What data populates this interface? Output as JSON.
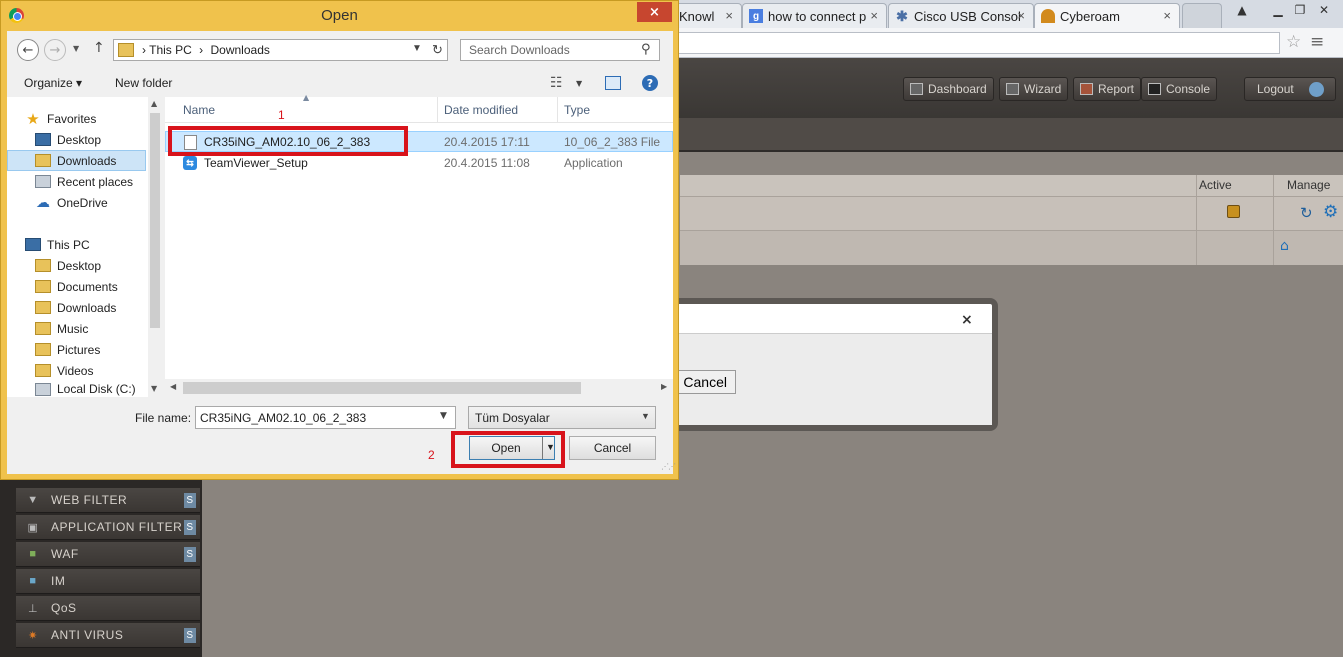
{
  "browser": {
    "tabs": [
      {
        "label": "Knowl"
      },
      {
        "label": "how to connect p"
      },
      {
        "label": "Cisco USB Consol"
      },
      {
        "label": "Cyberoam"
      }
    ]
  },
  "cyberoam": {
    "header_buttons": [
      {
        "label": "Dashboard"
      },
      {
        "label": "Wizard"
      },
      {
        "label": "Report"
      },
      {
        "label": "Console"
      }
    ],
    "logout_label": "Logout",
    "grid": {
      "col_active": "Active",
      "col_manage": "Manage"
    },
    "modal": {
      "cancel_label": "Cancel",
      "close": "×"
    },
    "sidebar": {
      "items": [
        {
          "label": "WEB FILTER",
          "badge": "S"
        },
        {
          "label": "APPLICATION FILTER",
          "badge": "S"
        },
        {
          "label": "WAF",
          "badge": "S"
        },
        {
          "label": "IM"
        },
        {
          "label": "QoS"
        },
        {
          "label": "ANTI VIRUS",
          "badge": "S"
        }
      ]
    }
  },
  "dialog": {
    "title": "Open",
    "close": "×",
    "address": {
      "segments": [
        "This PC",
        "Downloads"
      ],
      "separator": "›"
    },
    "search": {
      "placeholder": "Search Downloads"
    },
    "toolbar": {
      "organize": "Organize ▾",
      "new_folder": "New folder"
    },
    "nav": {
      "favorites": "Favorites",
      "fav_items": [
        "Desktop",
        "Downloads",
        "Recent places",
        "OneDrive"
      ],
      "this_pc": "This PC",
      "pc_items": [
        "Desktop",
        "Documents",
        "Downloads",
        "Music",
        "Pictures",
        "Videos",
        "Local Disk (C:)"
      ]
    },
    "columns": {
      "name": "Name",
      "date": "Date modified",
      "type": "Type"
    },
    "files": [
      {
        "name": "CR35iNG_AM02.10_06_2_383",
        "date": "20.4.2015 17:11",
        "type": "10_06_2_383 File"
      },
      {
        "name": "TeamViewer_Setup",
        "date": "20.4.2015 11:08",
        "type": "Application"
      }
    ],
    "file_name_label": "File name:",
    "file_name_value": "CR35iNG_AM02.10_06_2_383",
    "filter_value": "Tüm Dosyalar",
    "open_label": "Open",
    "cancel_label": "Cancel"
  },
  "annotations": {
    "step1": "1",
    "step2": "2",
    "color": "#d8131b"
  }
}
